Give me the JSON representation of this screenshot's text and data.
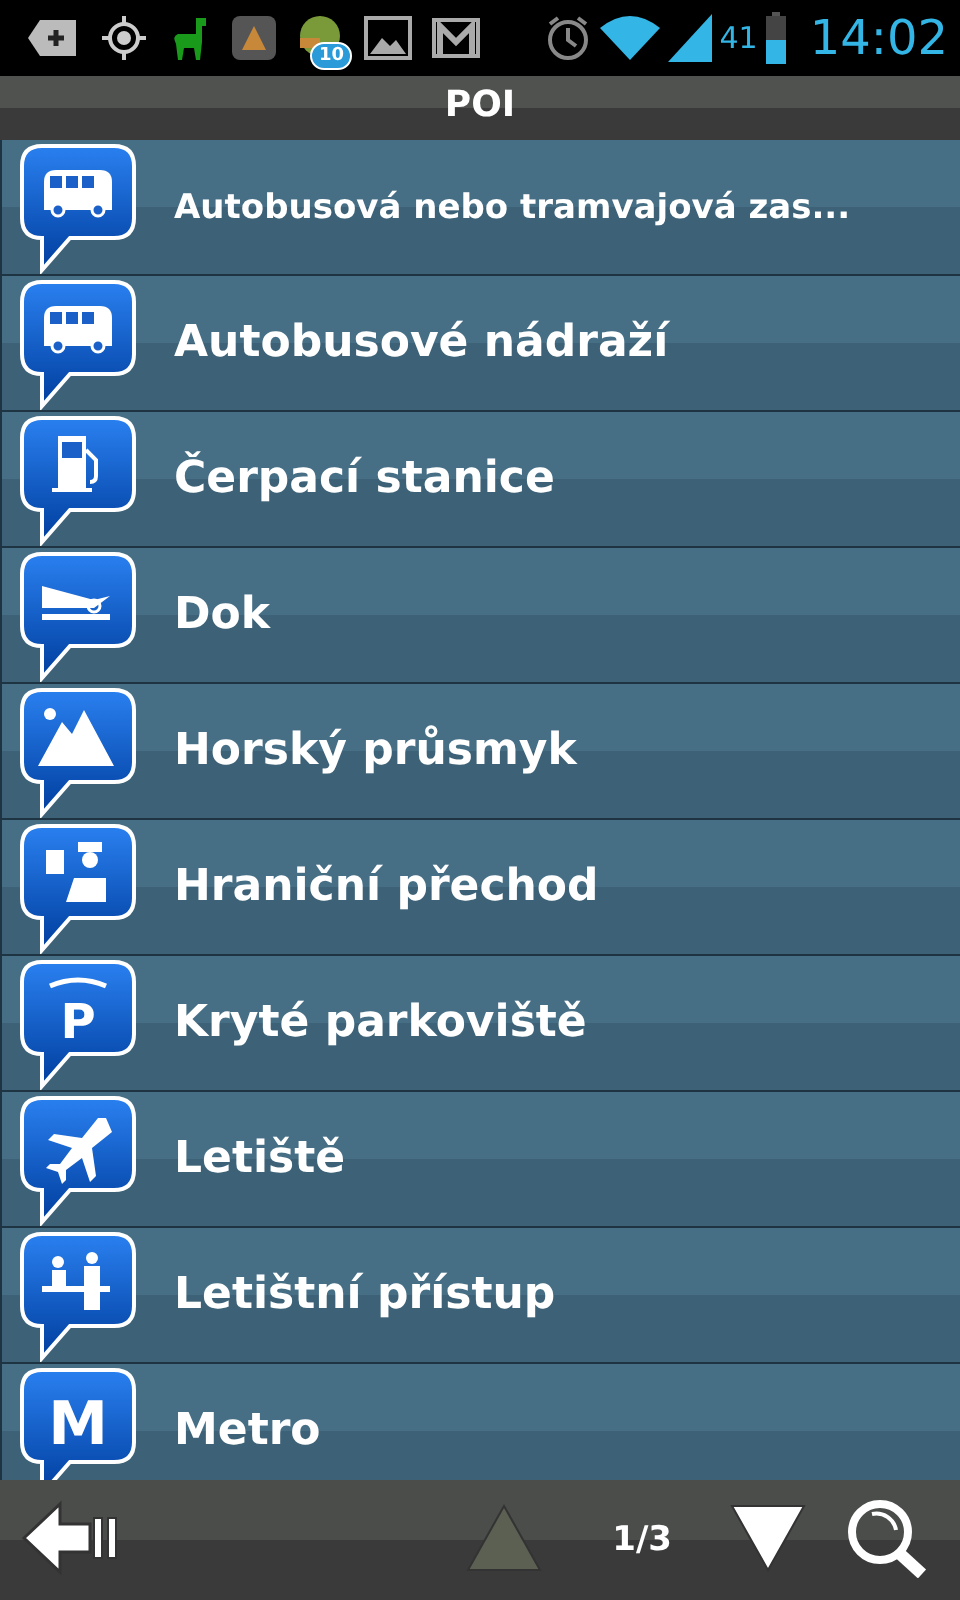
{
  "status_bar": {
    "badge": "10",
    "battery": "41",
    "time": "14:02"
  },
  "title": "POI",
  "items": [
    {
      "label": "Autobusová nebo tramvajová zas...",
      "kind": "bus"
    },
    {
      "label": "Autobusové nádraží",
      "kind": "bus"
    },
    {
      "label": "Čerpací stanice",
      "kind": "fuel"
    },
    {
      "label": "Dok",
      "kind": "dock"
    },
    {
      "label": "Horský průsmyk",
      "kind": "mountain"
    },
    {
      "label": "Hraniční přechod",
      "kind": "customs"
    },
    {
      "label": "Kryté parkoviště",
      "kind": "parking",
      "symbol": "P"
    },
    {
      "label": "Letiště",
      "kind": "airplane"
    },
    {
      "label": "Letištní přístup",
      "kind": "desk"
    },
    {
      "label": "Metro",
      "kind": "metro",
      "symbol": "M"
    }
  ],
  "pager": {
    "page": "1/3",
    "up_disabled": true,
    "down_disabled": false
  }
}
